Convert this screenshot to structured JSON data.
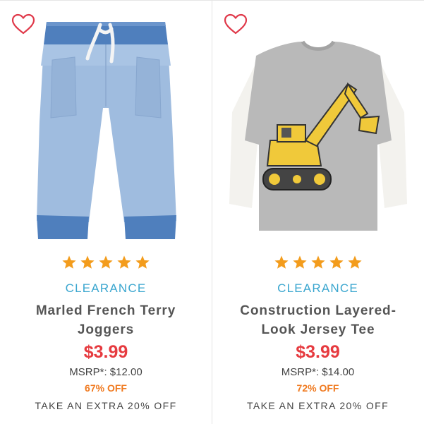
{
  "colors": {
    "clearance": "#3aa6cf",
    "price": "#e63a3f",
    "discount": "#f07a20",
    "star": "#f39c1c",
    "heart": "#e0394a"
  },
  "products": [
    {
      "favorite_icon": "heart-outline-icon",
      "image": "blue-marled-joggers",
      "rating": 5,
      "tag": "CLEARANCE",
      "name": "Marled French Terry Joggers",
      "price": "$3.99",
      "msrp": "MSRP*: $12.00",
      "discount": "67% OFF",
      "promo": "TAKE AN EXTRA 20% OFF"
    },
    {
      "favorite_icon": "heart-outline-icon",
      "image": "excavator-layered-tee",
      "rating": 5,
      "tag": "CLEARANCE",
      "name": "Construction Layered-Look Jersey Tee",
      "price": "$3.99",
      "msrp": "MSRP*: $14.00",
      "discount": "72% OFF",
      "promo": "TAKE AN EXTRA 20% OFF"
    }
  ]
}
